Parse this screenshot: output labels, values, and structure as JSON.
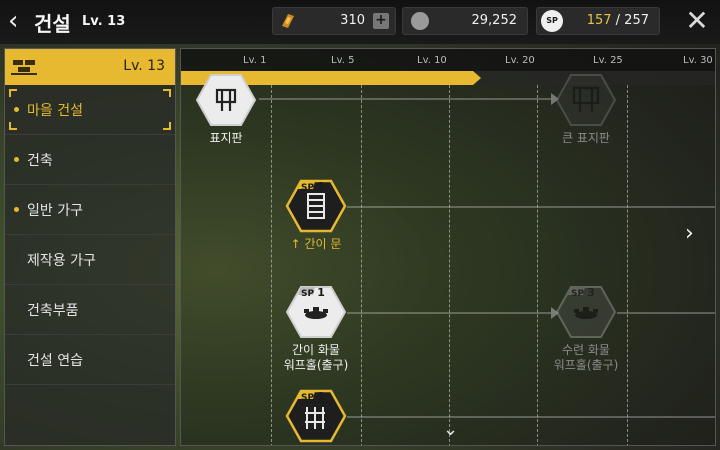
{
  "header": {
    "back_icon": "chevron-left-icon",
    "title": "건설",
    "level": "Lv. 13",
    "resources": [
      {
        "icon": "gold-ticket-icon",
        "value": "310",
        "add_icon": "plus-icon"
      },
      {
        "icon": "silver-coin-icon",
        "value": "29,252"
      },
      {
        "icon": "sp-icon",
        "icon_text": "SP",
        "current": "157",
        "separator": " / ",
        "max": "257"
      }
    ],
    "close_icon": "close-icon"
  },
  "sidebar": {
    "header_icon": "brick-icon",
    "header_level": "Lv. 13",
    "items": [
      {
        "label": "마을 건설",
        "selected": true,
        "dot": true
      },
      {
        "label": "건축",
        "selected": false,
        "dot": true
      },
      {
        "label": "일반 가구",
        "selected": false,
        "dot": true
      },
      {
        "label": "제작용 가구",
        "selected": false,
        "dot": false
      },
      {
        "label": "건축부품",
        "selected": false,
        "dot": false
      },
      {
        "label": "건설 연습",
        "selected": false,
        "dot": false
      }
    ]
  },
  "timeline": {
    "tick_labels": [
      "Lv. 1",
      "Lv. 5",
      "Lv. 10",
      "Lv. 20",
      "Lv. 25",
      "Lv. 30"
    ],
    "progress_fraction": 0.56,
    "nodes": [
      {
        "id": "sign",
        "label": "표지판",
        "sp": null,
        "style": "unlocked",
        "icon": "signboard-icon"
      },
      {
        "id": "big-sign",
        "label": "큰 표지판",
        "sp": null,
        "style": "locked",
        "icon": "signboard-icon"
      },
      {
        "id": "simple-door",
        "label": "간이 문",
        "label_prefix": "↑",
        "sp_label": "SP",
        "sp": "1",
        "style": "available",
        "icon": "door-icon"
      },
      {
        "id": "simple-warp",
        "label": "간이 화물\n워프홀(출구)",
        "sp_label": "SP",
        "sp": "1",
        "style": "unlocked",
        "icon": "warp-hole-icon"
      },
      {
        "id": "trained-warp",
        "label": "수련 화물\n워프홀(출구)",
        "sp_label": "SP",
        "sp": "3",
        "style": "locked",
        "icon": "warp-hole-icon"
      },
      {
        "id": "fence",
        "label": "",
        "sp_label": "SP",
        "sp": "1",
        "style": "available",
        "icon": "fence-icon"
      }
    ],
    "right_arrow_icon": "chevron-right-icon",
    "down_arrow_icon": "chevron-down-icon"
  },
  "colors": {
    "accent": "#e6b931",
    "locked": "#8a8a8a"
  }
}
